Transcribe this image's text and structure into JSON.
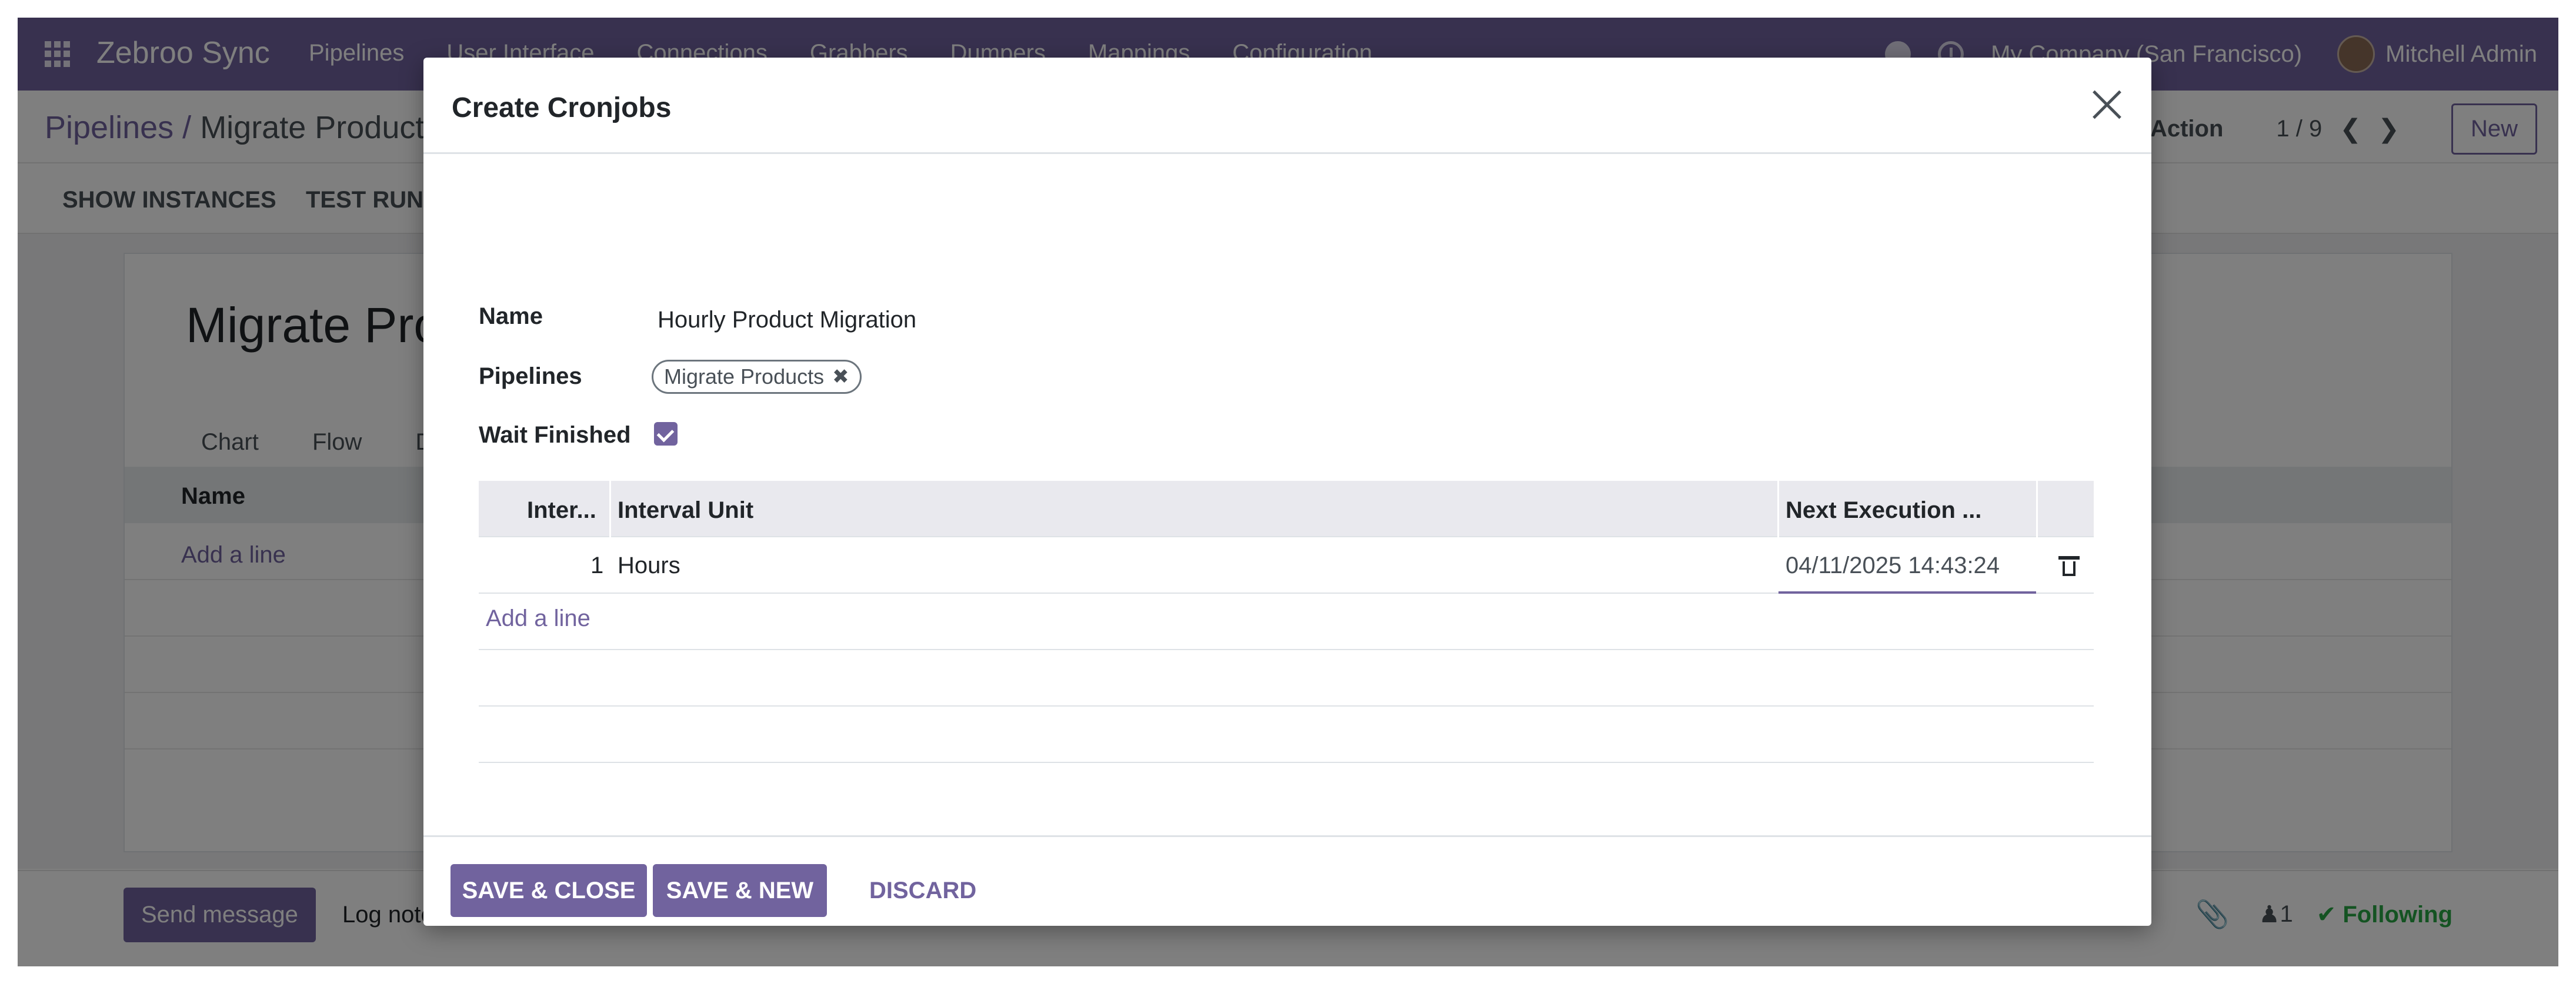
{
  "navbar": {
    "brand": "Zebroo Sync",
    "menu": [
      "Pipelines",
      "User Interface",
      "Connections",
      "Grabbers",
      "Dumpers",
      "Mappings",
      "Configuration"
    ],
    "company": "My Company (San Francisco)",
    "user": "Mitchell Admin"
  },
  "control_panel": {
    "breadcrumb_root": "Pipelines",
    "breadcrumb_sep": "/",
    "breadcrumb_current": "Migrate Products",
    "action_label": "Action",
    "pager": "1 / 9",
    "new_label": "New"
  },
  "statusbar": {
    "show_instances": "SHOW INSTANCES",
    "test_run": "TEST RUN"
  },
  "sheet": {
    "title": "Migrate Products",
    "tabs": [
      "Chart",
      "Flow",
      "De"
    ],
    "column_name": "Name",
    "add_line": "Add a line"
  },
  "chatter": {
    "send_message": "Send message",
    "log_note": "Log note",
    "followers_count": "1",
    "following": "Following"
  },
  "modal": {
    "title": "Create Cronjobs",
    "fields": {
      "name_label": "Name",
      "name_value": "Hourly Product Migration",
      "pipelines_label": "Pipelines",
      "pipeline_tag": "Migrate Products",
      "wait_finished_label": "Wait Finished",
      "wait_finished_checked": true
    },
    "table": {
      "headers": [
        "Inter...",
        "Interval Unit",
        "Next Execution ..."
      ],
      "rows": [
        {
          "interval": "1",
          "unit": "Hours",
          "next_execution": "04/11/2025 14:43:24"
        }
      ],
      "add_line": "Add a line"
    },
    "footer": {
      "save_close": "SAVE & CLOSE",
      "save_new": "SAVE & NEW",
      "discard": "DISCARD"
    }
  },
  "colors": {
    "brand": "#71639e",
    "success": "#28a745"
  }
}
